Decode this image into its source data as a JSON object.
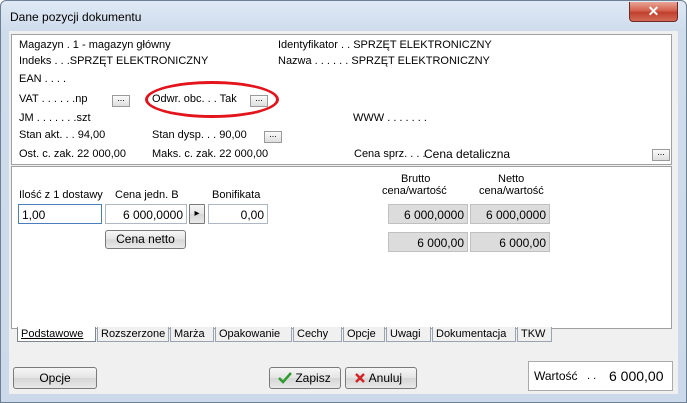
{
  "window": {
    "title": "Dane pozycji dokumentu",
    "close_glyph": "✕"
  },
  "info": {
    "magazyn": "Magazyn . 1 - magazyn główny",
    "identyfikator": "Identyfikator . . SPRZĘT ELEKTRONICZNY",
    "indeks": "Indeks . . .SPRZĘT ELEKTRONICZNY",
    "nazwa": "Nazwa . . . . . . SPRZĘT ELEKTRONICZNY",
    "ean": "EAN . . . .",
    "vat": "VAT . . . . . .np",
    "odwr": "Odwr. obc. . . Tak",
    "jm": "JM . . . . . . .szt",
    "www": "WWW . . . . . . .",
    "stan_akt": "Stan akt. . . 94,00",
    "stan_dysp": "Stan dysp. . . 90,00",
    "ost_c_zak": "Ost. c. zak. 22 000,00",
    "maks_c_zak": "Maks. c. zak. 22 000,00",
    "cena_sprz_label": "Cena sprz. . . .",
    "cena_sprz_value": "Cena detaliczna",
    "dots_glyph": "..."
  },
  "amounts": {
    "ilosc_label": "Ilość z 1 dostawy",
    "cena_jedn_label": "Cena jedn. B",
    "bonifikata_label": "Bonifikata",
    "ilosc_value": "1,00",
    "cena_jedn_value": "6 000,0000",
    "bonifikata_value": "0,00",
    "arrow_glyph": "▸",
    "cena_netto_button": "Cena netto",
    "brutto_label_1": "Brutto",
    "brutto_label_2": "cena/wartość",
    "netto_label_1": "Netto",
    "netto_label_2": "cena/wartość",
    "brutto_cena": "6 000,0000",
    "netto_cena": "6 000,0000",
    "brutto_wartosc": "6 000,00",
    "netto_wartosc": "6 000,00"
  },
  "tabs": [
    "Podstawowe",
    "Rozszerzone",
    "Marża",
    "Opakowanie",
    "Cechy",
    "Opcje",
    "Uwagi",
    "Dokumentacja",
    "TKW"
  ],
  "footer": {
    "opcje_button": "Opcje",
    "zapisz_button": "Zapisz",
    "anuluj_button": "Anuluj",
    "wartosc_label": "Wartość",
    "wartosc_value": "6 000,00"
  },
  "colors": {
    "annotation_ellipse": "#e3141b",
    "save_icon": "#2e9d2e",
    "cancel_icon": "#d42424"
  }
}
